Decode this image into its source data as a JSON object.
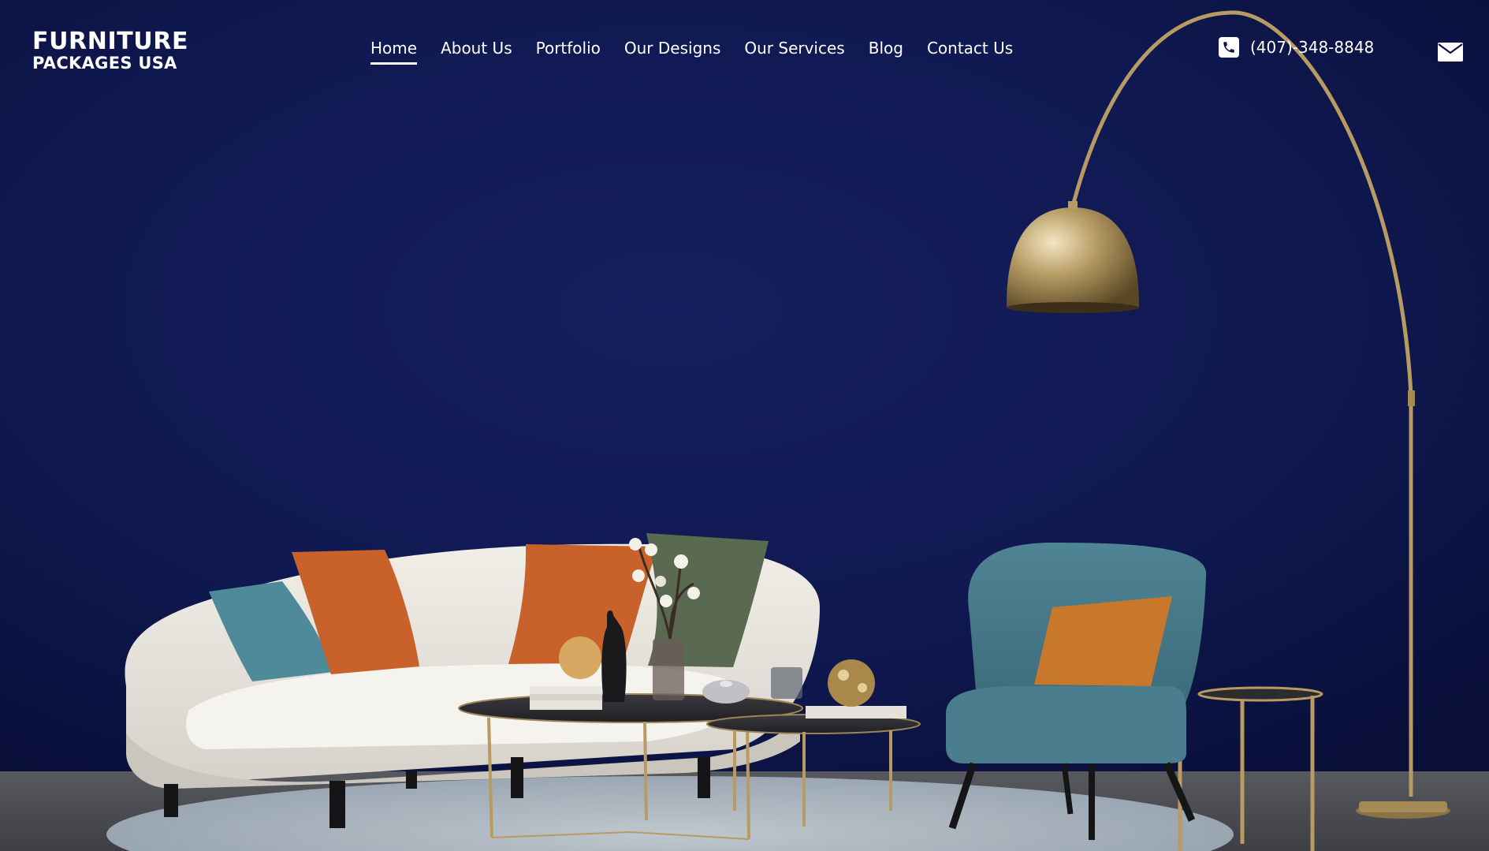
{
  "brand": {
    "line1": "FURNITURE",
    "line2": "PACKAGES USA"
  },
  "nav": {
    "items": [
      {
        "label": "Home",
        "active": true
      },
      {
        "label": "About Us"
      },
      {
        "label": "Portfolio"
      },
      {
        "label": "Our Designs"
      },
      {
        "label": "Our Services"
      },
      {
        "label": "Blog"
      },
      {
        "label": "Contact Us"
      }
    ]
  },
  "contact": {
    "phone": "(407)-348-8848",
    "phone_icon": "phone-icon",
    "mail_icon": "envelope-icon"
  },
  "colors": {
    "wall": "#0e1647",
    "text": "#ffffff",
    "sofa": "#e7e3dc",
    "accent_orange": "#c9612a",
    "accent_teal": "#4d8a9a",
    "brass": "#b89a63"
  }
}
